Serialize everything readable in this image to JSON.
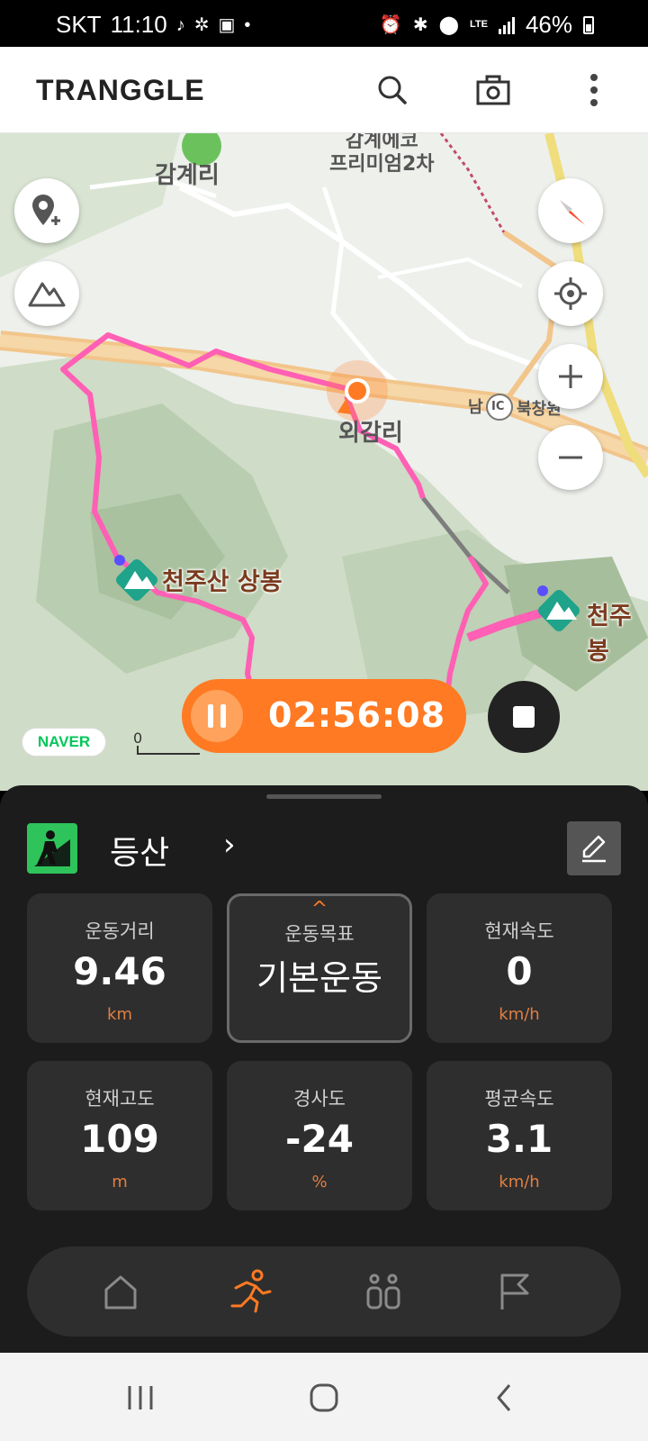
{
  "status_bar": {
    "carrier": "SKT",
    "time": "11:10",
    "network": "LTE",
    "battery": "46%",
    "battery_level": 0.46
  },
  "header": {
    "logo": "TRANGGLE",
    "icons": [
      "search-icon",
      "camera-icon",
      "more-icon"
    ]
  },
  "map": {
    "labels": {
      "village_1": "감계리",
      "apartment": "감계에코\n프리미엄2차",
      "village_2": "외감리",
      "ic": "북창원",
      "ic_badge": "IC",
      "road_prefix": "남"
    },
    "peaks": [
      {
        "name": "천주산 상봉"
      },
      {
        "name": "천주봉"
      }
    ],
    "attribution": "NAVER",
    "scale_zero": "0",
    "route_color": "#ff5fb4",
    "accent_color": "#ff7a22"
  },
  "recording": {
    "elapsed": "02:56:08"
  },
  "panel": {
    "activity": "등산",
    "activity_color": "#2ec45b",
    "stats": [
      {
        "label": "운동거리",
        "value": "9.46",
        "unit": "km"
      },
      {
        "label": "운동목표",
        "value": "기본운동",
        "unit": "",
        "caret": "^"
      },
      {
        "label": "현재속도",
        "value": "0",
        "unit": "km/h"
      },
      {
        "label": "현재고도",
        "value": "109",
        "unit": "m"
      },
      {
        "label": "경사도",
        "value": "-24",
        "unit": "%"
      },
      {
        "label": "평균속도",
        "value": "3.1",
        "unit": "km/h"
      }
    ],
    "tabs": [
      "home-icon",
      "exercise-icon",
      "people-icon",
      "flag-icon"
    ],
    "active_tab": 1
  },
  "system_nav": [
    "recent-apps-icon",
    "home-circle-icon",
    "back-icon"
  ]
}
